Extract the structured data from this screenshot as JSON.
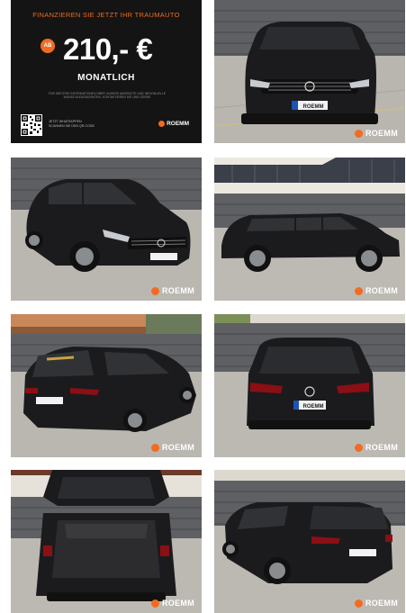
{
  "promo": {
    "headline": "FINANZIEREN SIE  JETZT IHR TRAUMAUTO",
    "badge": "AB",
    "price": "210,- €",
    "period": "MONATLICH",
    "fine_print": "FÜR WEITERE INFORMATIONEN ÜBER UNSERE ANGEBOTE UND INDIVIDUELLE WUNSCHLEASINGRATEN, KONTAKTIEREN SIE UNS GERNE",
    "whatsapp_line1": "JETZT WHATSAPPEN",
    "whatsapp_line2": "SCANNEN SIE DEN QR-CODE",
    "brand": "ROEMM"
  },
  "watermark": "ROEMM",
  "plate_text": "ROEMM",
  "colors": {
    "accent": "#f26b21",
    "car_body": "#1b1b1d",
    "fence": "#55585b",
    "ground": "#b7b4ae"
  },
  "gallery": [
    {
      "id": "front",
      "view": "front"
    },
    {
      "id": "front-left",
      "view": "three-quarter front"
    },
    {
      "id": "side",
      "view": "side"
    },
    {
      "id": "rear-left",
      "view": "three-quarter rear"
    },
    {
      "id": "rear",
      "view": "rear"
    },
    {
      "id": "trunk",
      "view": "open trunk"
    },
    {
      "id": "rear-right",
      "view": "three-quarter rear right"
    }
  ]
}
